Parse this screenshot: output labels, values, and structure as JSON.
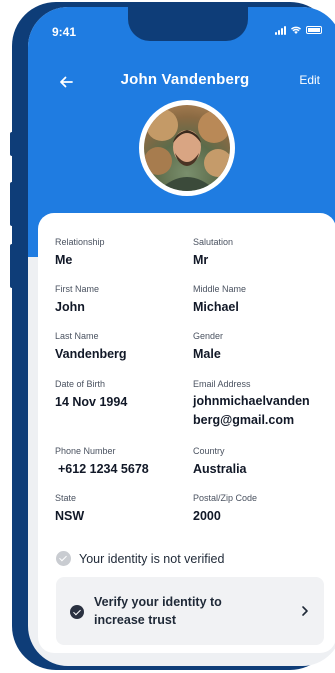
{
  "status_bar": {
    "time": "9:41"
  },
  "header": {
    "title": "John Vandenberg",
    "edit_label": "Edit"
  },
  "fields": {
    "relationship": {
      "label": "Relationship",
      "value": "Me"
    },
    "salutation": {
      "label": "Salutation",
      "value": "Mr"
    },
    "first_name": {
      "label": "First Name",
      "value": "John"
    },
    "middle_name": {
      "label": "Middle Name",
      "value": "Michael"
    },
    "last_name": {
      "label": "Last Name",
      "value": "Vandenberg"
    },
    "gender": {
      "label": "Gender",
      "value": "Male"
    },
    "dob": {
      "label": "Date of Birth",
      "value": "14 Nov 1994"
    },
    "email": {
      "label": "Email Address",
      "value_line1": "johnmichaelvanden",
      "value_line2": "berg@gmail.com"
    },
    "phone": {
      "label": "Phone Number",
      "value": "+612 1234 5678"
    },
    "country": {
      "label": "Country",
      "value": "Australia"
    },
    "state": {
      "label": "State",
      "value": "NSW"
    },
    "postal": {
      "label": "Postal/Zip Code",
      "value": "2000"
    }
  },
  "verification": {
    "status_text": "Your identity is not verified",
    "cta_line1": "Verify your identity to",
    "cta_line2": "increase trust"
  },
  "colors": {
    "header_blue": "#1f7ce1",
    "frame_navy": "#0e3d78"
  }
}
